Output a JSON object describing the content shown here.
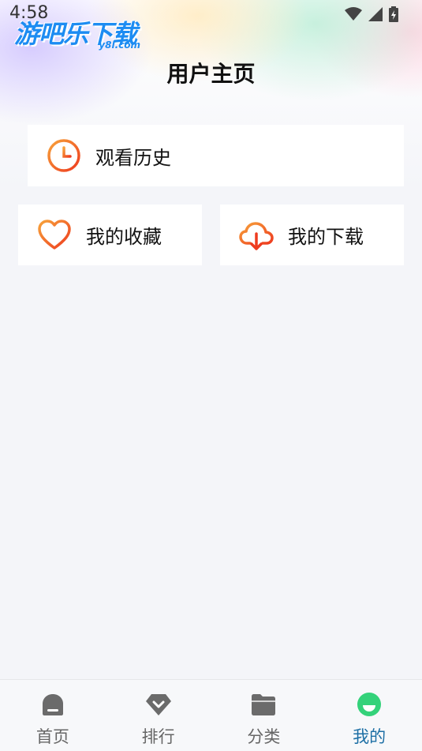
{
  "status_bar": {
    "time": "4:58"
  },
  "logo": {
    "text": "游吧乐下载",
    "sub": "y8l.com"
  },
  "page_title": "用户主页",
  "cards": {
    "history": {
      "label": "观看历史",
      "icon": "clock-icon"
    },
    "favorites": {
      "label": "我的收藏",
      "icon": "heart-icon"
    },
    "downloads": {
      "label": "我的下载",
      "icon": "cloud-download-icon"
    }
  },
  "bottom_nav": [
    {
      "label": "首页",
      "icon": "home-icon",
      "active": false
    },
    {
      "label": "排行",
      "icon": "ranking-icon",
      "active": false
    },
    {
      "label": "分类",
      "icon": "folder-icon",
      "active": false
    },
    {
      "label": "我的",
      "icon": "profile-icon",
      "active": true
    }
  ],
  "colors": {
    "accent_orange": "#f26b21",
    "accent_blue": "#1d6fa5",
    "nav_inactive": "#666666",
    "profile_green": "#34d27a"
  }
}
